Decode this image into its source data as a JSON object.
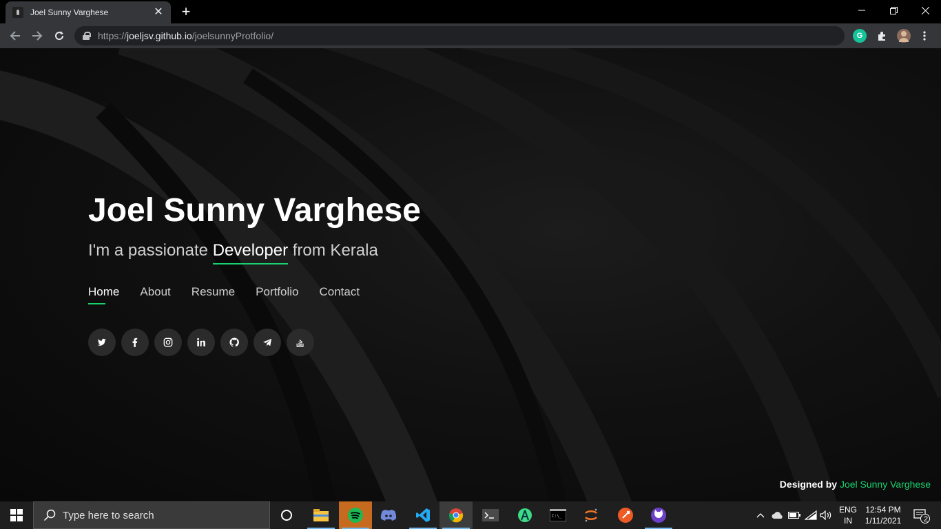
{
  "browser": {
    "tab_title": "Joel Sunny Varghese",
    "new_tab_label": "+",
    "url_scheme": "https://",
    "url_host": "joeljsv.github.io",
    "url_path": "/joelsunnyProtfolio/",
    "extensions": [
      {
        "name": "grammarly-icon",
        "color": "#15c39a"
      },
      {
        "name": "extensions-icon"
      },
      {
        "name": "profile-avatar"
      }
    ]
  },
  "hero": {
    "name": "Joel Sunny Varghese",
    "sub_prefix": "I'm a passionate ",
    "sub_typed": "Developer",
    "sub_suffix": " from Kerala"
  },
  "nav": {
    "items": [
      {
        "label": "Home",
        "active": true
      },
      {
        "label": "About"
      },
      {
        "label": "Resume"
      },
      {
        "label": "Portfolio"
      },
      {
        "label": "Contact"
      }
    ]
  },
  "social": [
    "twitter-icon",
    "facebook-icon",
    "instagram-icon",
    "linkedin-icon",
    "github-icon",
    "telegram-icon",
    "stackoverflow-icon"
  ],
  "credits": {
    "prefix": "Designed by ",
    "name": "Joel Sunny Varghese",
    "accent_color": "#18d26e"
  },
  "taskbar": {
    "search_placeholder": "Type here to search",
    "apps": [
      "cortana-icon",
      "file-explorer-icon",
      "spotify-icon",
      "discord-icon",
      "vscode-icon",
      "chrome-icon",
      "terminal-icon",
      "android-studio-icon",
      "cmd-icon",
      "jupyter-icon",
      "postman-icon",
      "github-desktop-icon"
    ],
    "lang_top": "ENG",
    "lang_bottom": "IN",
    "time": "12:54 PM",
    "date": "1/11/2021",
    "notification_count": "2"
  }
}
